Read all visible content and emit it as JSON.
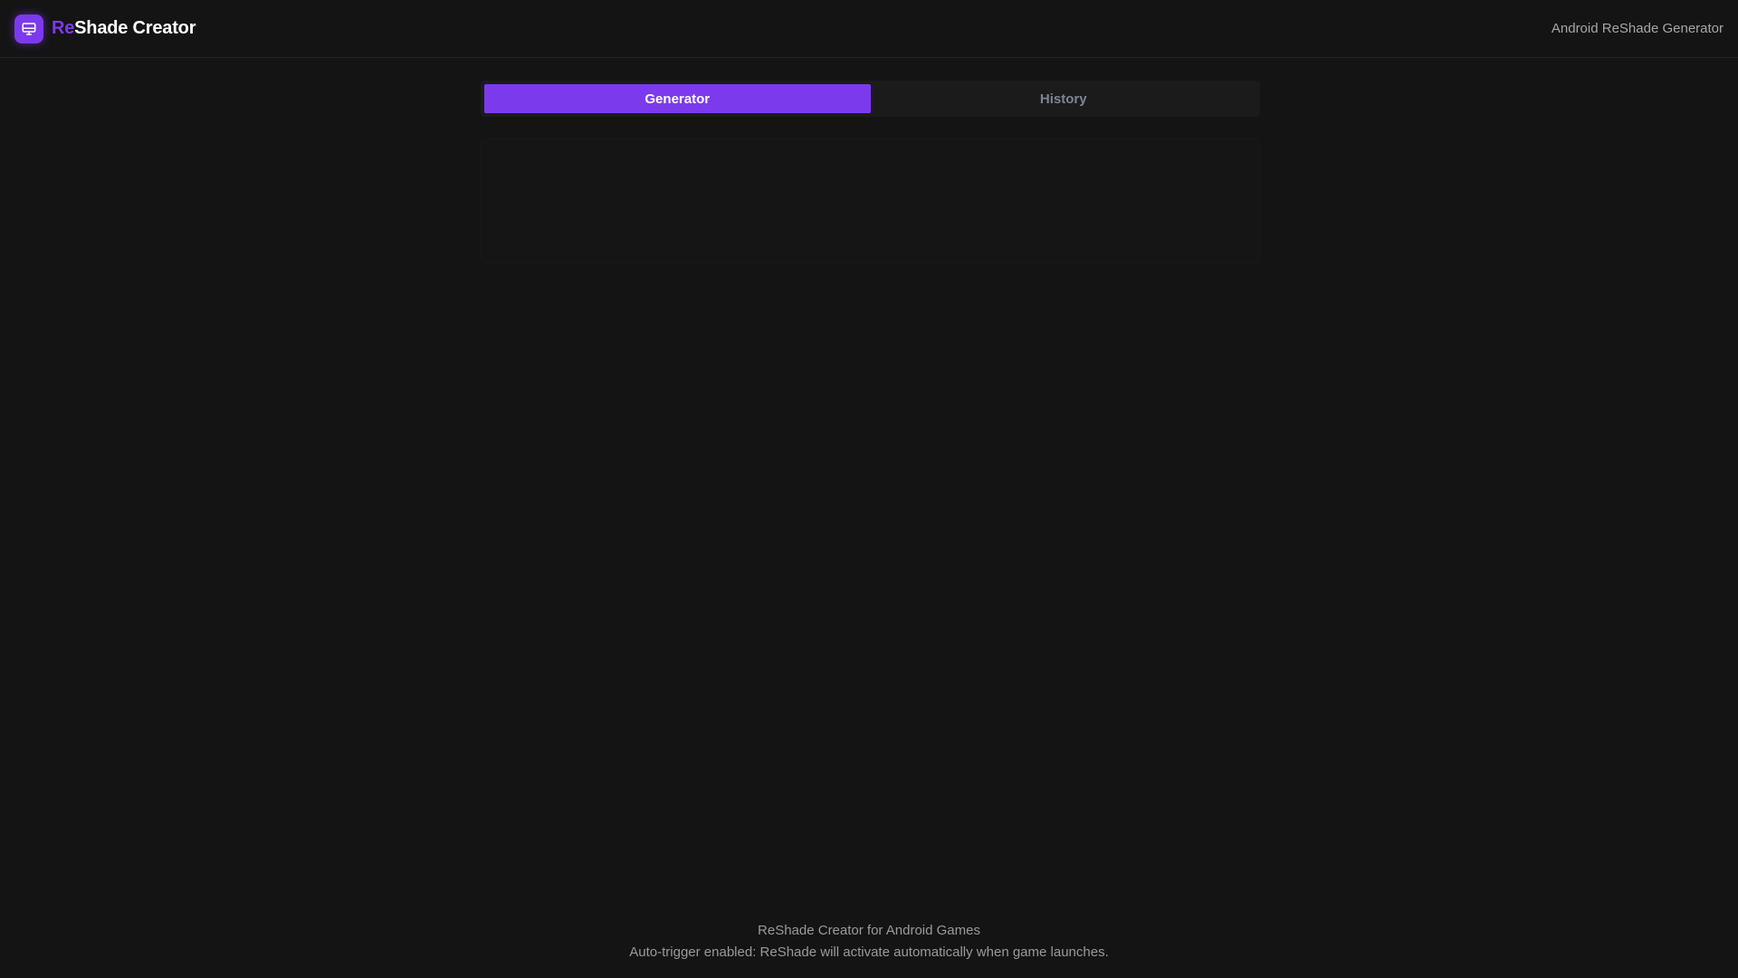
{
  "header": {
    "brand_prefix": "Re",
    "brand_suffix": "Shade Creator",
    "logo_icon": "monitor-icon",
    "subtitle": "Android ReShade Generator"
  },
  "tabs": [
    {
      "label": "Generator",
      "active": true
    },
    {
      "label": "History",
      "active": false
    }
  ],
  "footer": {
    "line1": "ReShade Creator for Android Games",
    "line2": "Auto-trigger enabled: ReShade will activate automatically when game launches."
  },
  "colors": {
    "accent": "#7c3aed",
    "background": "#141414",
    "tab_inactive_text": "#7d8594"
  }
}
